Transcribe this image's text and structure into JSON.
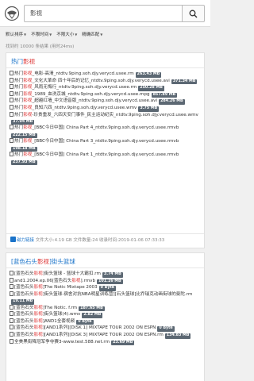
{
  "search": {
    "query": "影视"
  },
  "filters": [
    {
      "label": "默认排序"
    },
    {
      "label": "不限时间"
    },
    {
      "label": "不限大小"
    },
    {
      "label": "精确匹配"
    }
  ],
  "summary": "找到约 10000 条结果 (用时24ms)",
  "results": [
    {
      "title_parts": [
        "热门",
        "影视",
        ""
      ],
      "items": [
        {
          "parts": [
            "热门",
            "影视",
            "_电影-高清_ntdtv.9ping.soh.djy.verycd.usee.rm"
          ],
          "size": "263.43 MB"
        },
        {
          "parts": [
            "热门",
            "影视",
            "_文化大革命 四十年后的记忆_ntdtv.9ping.soh.djy.verycd.usee.avi"
          ],
          "size": "371.34 MB"
        },
        {
          "parts": [
            "热门",
            "影视",
            "_风雨无悔行_ntdtv.9ping.soh.djy.verycd.usee.rm"
          ],
          "size": "250.28 MB"
        },
        {
          "parts": [
            "热门",
            "影视",
            "_1989_血洗京城_ntdtv.9ping.soh.djy.verycd.usee.mpg"
          ],
          "size": "857.89 MB"
        },
        {
          "parts": [
            "热门",
            "影视",
            "_超越红墙_中文语音版_ntdtv.9ping.soh.djy.verycd.usee.avi"
          ],
          "size": "284.26 MB"
        },
        {
          "parts": [
            "热门",
            "影视",
            "_良知六四_ntdtv.9ping.soh.djy.verycd.usee.wmv"
          ],
          "size": "3.75 MB"
        },
        {
          "parts": [
            "热门",
            "影视",
            "-珍贵重发_六四天安门事件_民主运动纪实_ntdtv.9ping.soh.djy.verycd.usee.wmv"
          ],
          "size": "37.04 MB"
        },
        {
          "parts": [
            "热门",
            "影视",
            "_[BBC今日中国] China Part 4_ntdtv.9ping.soh.djy.verycd.usee.rmvb"
          ],
          "size": "222.15 MB"
        },
        {
          "parts": [
            "热门",
            "影视",
            "_[BBC今日中国] China Part 3_ntdtv.9ping.soh.djy.verycd.usee.rmvb"
          ],
          "size": "198.18 MB"
        },
        {
          "parts": [
            "热门",
            "影视",
            "_[BBC今日中国] China Part 1_ntdtv.9ping.soh.djy.verycd.usee.rmvb"
          ],
          "size": "237.93 MB"
        }
      ],
      "footer": {
        "magnet": "磁力链接",
        "filesize_label": "文件大小:",
        "filesize": "4.19 GB",
        "count_label": "文件数量:",
        "count": "24",
        "date_label": "收录时间:",
        "date": "2019-01-06 07:33:33"
      }
    },
    {
      "title_parts": [
        "[蓝色石头",
        "影视",
        "]街头篮球"
      ],
      "items": [
        {
          "parts": [
            "[蓝色石头",
            "影视",
            "]街头篮球 - 篮球十大霸扣.rm"
          ],
          "size": "3.74 MB"
        },
        {
          "parts": [
            "and1.2004.ep.06[蓝色石头",
            "影视",
            "].rmvb"
          ],
          "size": "101.16 MB"
        },
        {
          "parts": [
            "[蓝色石头",
            "影视",
            "]The Notic Mixtape 2003"
          ],
          "size": "0 Byte"
        },
        {
          "parts": [
            "[蓝色石头",
            "影视",
            "]街头篮球-宿舍对抗NBA明星训练营][石头篮球]比乔瑞克动画街球的曼陀.rm"
          ],
          "size": "19.11 MB"
        },
        {
          "parts": [
            "[蓝色石头",
            "影视",
            "]The Notic. f.rm"
          ],
          "size": "187.65 MB"
        },
        {
          "parts": [
            "[蓝色石头",
            "影视",
            "]街头篮球(4).wmv"
          ],
          "size": "2.82 MB"
        },
        {
          "parts": [
            "[蓝色石头",
            "影视",
            "]AND1全套视频"
          ],
          "size": "0 Byte"
        },
        {
          "parts": [
            "[蓝色石头",
            "影视",
            "][AND1系列][DISK 1] MIXTAPE TOUR 2002 ON ESPN"
          ],
          "size": "0 Byte"
        },
        {
          "parts": [
            "[蓝色石头",
            "影视",
            "][AND1系列][DISK 3] MIXTAPE TOUR 2002 ON ESPN.rm"
          ],
          "size": "134.83 MB"
        },
        {
          "parts": [
            "",
            "",
            "全美黑街降冠军争夺赛3-www.test.588.net.rm"
          ],
          "size": "23.69 MB"
        }
      ]
    }
  ]
}
